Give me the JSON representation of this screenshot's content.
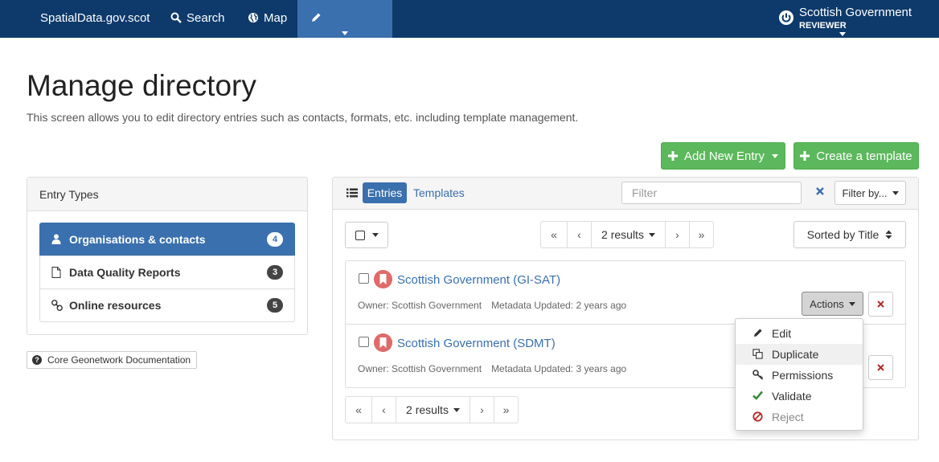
{
  "navbar": {
    "brand": "SpatialData.gov.scot",
    "items": [
      {
        "label": "Search",
        "icon": "search-icon"
      },
      {
        "label": "Map",
        "icon": "globe-icon"
      },
      {
        "label": "Contribute",
        "icon": "pencil-icon",
        "active": true
      }
    ],
    "user": {
      "name": "Scottish Government",
      "role": "REVIEWER",
      "icon": "power-icon"
    }
  },
  "page": {
    "title": "Manage directory",
    "lead": "This screen allows you to edit directory entries such as contacts, formats, etc. including template management."
  },
  "actions": {
    "add_new_entry": "Add New Entry",
    "create_template": "Create a template"
  },
  "entry_types": {
    "title": "Entry Types",
    "items": [
      {
        "label": "Organisations & contacts",
        "count": "4",
        "icon": "user-icon",
        "active": true
      },
      {
        "label": "Data Quality Reports",
        "count": "3",
        "icon": "file-icon"
      },
      {
        "label": "Online resources",
        "count": "5",
        "icon": "link-icon"
      }
    ]
  },
  "documentation": {
    "label": "Core Geonetwork Documentation",
    "icon": "question-circle-icon"
  },
  "entries_panel": {
    "tab_entries": "Entries",
    "tab_templates": "Templates",
    "filter_placeholder": "Filter",
    "filter_by": "Filter by...",
    "sort": "Sorted by Title",
    "results": "2 results",
    "pager": {
      "first": "«",
      "prev": "‹",
      "next": "›",
      "last": "»"
    }
  },
  "entries": [
    {
      "title": "Scottish Government (GI-SAT)",
      "owner": "Owner: Scottish Government",
      "updated": "Metadata Updated: 2 years ago"
    },
    {
      "title": "Scottish Government (SDMT)",
      "owner": "Owner: Scottish Government",
      "updated": "Metadata Updated: 3 years ago"
    }
  ],
  "row_actions": {
    "label": "Actions",
    "menu": [
      {
        "label": "Edit",
        "icon": "pencil-icon"
      },
      {
        "label": "Duplicate",
        "icon": "copy-icon",
        "hover": true
      },
      {
        "label": "Permissions",
        "icon": "key-icon"
      },
      {
        "label": "Validate",
        "icon": "check-icon"
      },
      {
        "label": "Reject",
        "icon": "ban-icon"
      }
    ]
  },
  "colors": {
    "navbar": "#0d3a6b",
    "nav_active": "#3a70ad",
    "primary": "#3a70ad",
    "success": "#5cb85c",
    "danger": "#b52b27",
    "record_icon": "#e06a6a"
  }
}
